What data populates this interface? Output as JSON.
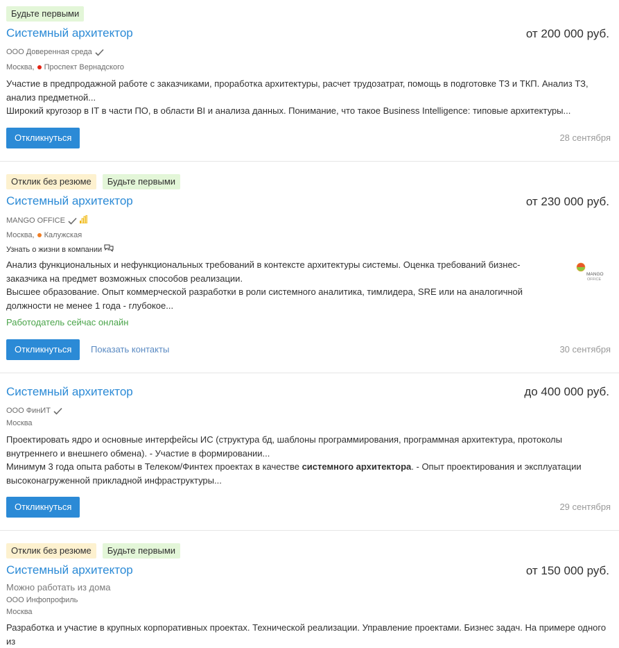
{
  "vacancies": [
    {
      "badges": [
        "Будьте первыми"
      ],
      "title": "Системный архитектор",
      "salary": "от 200 000 руб.",
      "company": "ООО Доверенная среда",
      "city": "Москва,",
      "metro": "Проспект Вернадского",
      "metro_color": "#e42313",
      "desc1": "Участие в предпродажной работе с заказчиками, проработка архитектуры, расчет трудозатрат, помощь в подготовке ТЗ и ТКП. Анализ ТЗ, анализ предметной...",
      "desc2": "Широкий кругозор в IT в части ПО, в области BI и анализа данных. Понимание, что такое Business Intelligence: типовые архитектуры...",
      "respond": "Откликнуться",
      "date": "28 сентября"
    },
    {
      "badges": [
        "Отклик без резюме",
        "Будьте первыми"
      ],
      "title": "Системный архитектор",
      "salary": "от 230 000 руб.",
      "company": "MANGO OFFICE",
      "city": "Москва,",
      "metro": "Калужская",
      "metro_color": "#f07e24",
      "life": "Узнать о жизни в компании",
      "desc1": "Анализ функциональных и нефункциональных требований в контексте архитектуры системы. Оценка требований бизнес-заказчика на предмет возможных способов реализации.",
      "desc2": "Высшее образование. Опыт коммерческой разработки в роли системного аналитика, тимлидера, SRE или на аналогичной должности не менее 1 года - глубокое...",
      "online": "Работодатель сейчас онлайн",
      "respond": "Откликнуться",
      "contacts": "Показать контакты",
      "date": "30 сентября",
      "logo_text1": "MANGO",
      "logo_text2": "OFFICE"
    },
    {
      "badges": [],
      "title": "Системный архитектор",
      "salary": "до 400 000 руб.",
      "company": "ООО ФинИТ",
      "city": "Москва",
      "desc1": "Проектировать ядро и основные интерфейсы ИС (структура бд, шаблоны программирования, программная архитектура, протоколы внутреннего и внешнего обмена). - Участие в формировании...",
      "desc2_pre": "Минимум 3 года опыта работы в Телеком/Финтех проектах в качестве ",
      "desc2_bold": "системного архитектора",
      "desc2_post": ". - Опыт проектирования и эксплуатации высоконагруженной прикладной инфраструктуры...",
      "respond": "Откликнуться",
      "date": "29 сентября"
    },
    {
      "badges": [
        "Отклик без резюме",
        "Будьте первыми"
      ],
      "title": "Системный архитектор",
      "salary": "от 150 000 руб.",
      "remote": "Можно работать из дома",
      "company": "ООО Инфопрофиль",
      "city": "Москва",
      "desc1": "Разработка и участие в крупных корпоративных проектах. Технической реализации. Управление проектами. Бизнес задач. На примере одного из"
    }
  ],
  "colors": {
    "link": "#2b8ad6",
    "badge_green": "#e3f6d8",
    "badge_yellow": "#fdf1cf",
    "online": "#4aa44a"
  }
}
